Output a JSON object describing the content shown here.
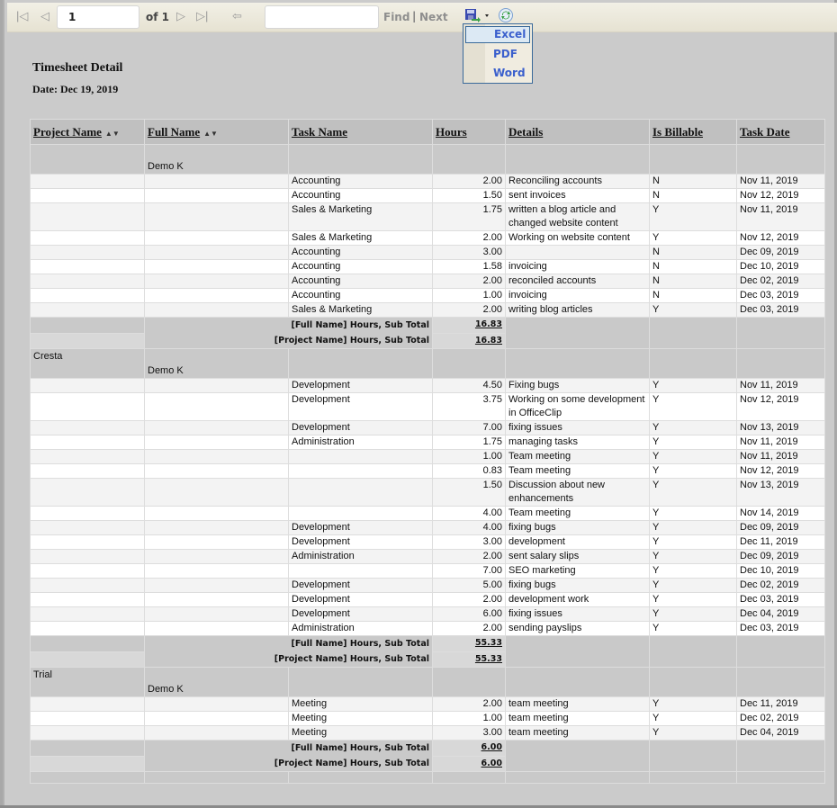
{
  "toolbar": {
    "page_value": "1",
    "of_label": "of 1",
    "find_placeholder": "",
    "find_label": "Find",
    "separator": "|",
    "next_label": "Next",
    "icons": [
      "first-page-icon",
      "prev-page-icon",
      "next-page-icon",
      "last-page-icon",
      "back-icon",
      "export-save-icon",
      "dropdown-arrow-icon",
      "refresh-icon"
    ]
  },
  "export_menu": {
    "items": [
      {
        "label": "Excel",
        "selected": true
      },
      {
        "label": "PDF",
        "selected": false
      },
      {
        "label": "Word",
        "selected": false
      }
    ]
  },
  "report": {
    "title": "Timesheet Detail",
    "date_label": "Date:  Dec 19, 2019"
  },
  "columns": [
    "Project Name",
    "Full Name",
    "Task Name",
    "Hours",
    "Details",
    "Is Billable",
    "Task Date"
  ],
  "sortable_columns": [
    "Project Name",
    "Full Name"
  ],
  "groups": [
    {
      "project": "",
      "full_name": "Demo K",
      "rows": [
        {
          "task": "Accounting",
          "hours": "2.00",
          "details": "Reconciling accounts",
          "billable": "N",
          "date": "Nov 11, 2019"
        },
        {
          "task": "Accounting",
          "hours": "1.50",
          "details": "sent invoices",
          "billable": "N",
          "date": "Nov 12, 2019"
        },
        {
          "task": "Sales & Marketing",
          "hours": "1.75",
          "details": "written a blog article and changed website content",
          "billable": "Y",
          "date": "Nov 11, 2019"
        },
        {
          "task": "Sales & Marketing",
          "hours": "2.00",
          "details": "Working on website content",
          "billable": "Y",
          "date": "Nov 12, 2019"
        },
        {
          "task": "Accounting",
          "hours": "3.00",
          "details": "",
          "billable": "N",
          "date": "Dec 09, 2019"
        },
        {
          "task": "Accounting",
          "hours": "1.58",
          "details": "invoicing",
          "billable": "N",
          "date": "Dec 10, 2019"
        },
        {
          "task": "Accounting",
          "hours": "2.00",
          "details": "reconciled accounts",
          "billable": "N",
          "date": "Dec 02, 2019"
        },
        {
          "task": "Accounting",
          "hours": "1.00",
          "details": "invoicing",
          "billable": "N",
          "date": "Dec 03, 2019"
        },
        {
          "task": "Sales & Marketing",
          "hours": "2.00",
          "details": "writing blog articles",
          "billable": "Y",
          "date": "Dec 03, 2019"
        }
      ],
      "fullname_subtotal_label": "[Full Name] Hours, Sub Total",
      "fullname_subtotal": "16.83",
      "project_subtotal_label": "[Project Name] Hours, Sub Total",
      "project_subtotal": "16.83"
    },
    {
      "project": "Cresta",
      "full_name": "Demo K",
      "rows": [
        {
          "task": "Development",
          "hours": "4.50",
          "details": "Fixing bugs",
          "billable": "Y",
          "date": "Nov 11, 2019"
        },
        {
          "task": "Development",
          "hours": "3.75",
          "details": "Working on some development in OfficeClip",
          "billable": "Y",
          "date": "Nov 12, 2019"
        },
        {
          "task": "Development",
          "hours": "7.00",
          "details": "fixing issues",
          "billable": "Y",
          "date": "Nov 13, 2019"
        },
        {
          "task": "Administration",
          "hours": "1.75",
          "details": "managing tasks",
          "billable": "Y",
          "date": "Nov 11, 2019"
        },
        {
          "task": "",
          "hours": "1.00",
          "details": "Team meeting",
          "billable": "Y",
          "date": "Nov 11, 2019"
        },
        {
          "task": "",
          "hours": "0.83",
          "details": "Team meeting",
          "billable": "Y",
          "date": "Nov 12, 2019"
        },
        {
          "task": "",
          "hours": "1.50",
          "details": "Discussion about new enhancements",
          "billable": "Y",
          "date": "Nov 13, 2019"
        },
        {
          "task": "",
          "hours": "4.00",
          "details": "Team meeting",
          "billable": "Y",
          "date": "Nov 14, 2019"
        },
        {
          "task": "Development",
          "hours": "4.00",
          "details": "fixing bugs",
          "billable": "Y",
          "date": "Dec 09, 2019"
        },
        {
          "task": "Development",
          "hours": "3.00",
          "details": "development",
          "billable": "Y",
          "date": "Dec 11, 2019"
        },
        {
          "task": "Administration",
          "hours": "2.00",
          "details": "sent salary slips",
          "billable": "Y",
          "date": "Dec 09, 2019"
        },
        {
          "task": "",
          "hours": "7.00",
          "details": "SEO marketing",
          "billable": "Y",
          "date": "Dec 10, 2019"
        },
        {
          "task": "Development",
          "hours": "5.00",
          "details": "fixing bugs",
          "billable": "Y",
          "date": "Dec 02, 2019"
        },
        {
          "task": "Development",
          "hours": "2.00",
          "details": "development work",
          "billable": "Y",
          "date": "Dec 03, 2019"
        },
        {
          "task": "Development",
          "hours": "6.00",
          "details": "fixing issues",
          "billable": "Y",
          "date": "Dec 04, 2019"
        },
        {
          "task": "Administration",
          "hours": "2.00",
          "details": "sending payslips",
          "billable": "Y",
          "date": "Dec 03, 2019"
        }
      ],
      "fullname_subtotal_label": "[Full Name] Hours, Sub Total",
      "fullname_subtotal": "55.33",
      "project_subtotal_label": "[Project Name] Hours, Sub Total",
      "project_subtotal": "55.33"
    },
    {
      "project": "Trial",
      "full_name": "Demo K",
      "rows": [
        {
          "task": "Meeting",
          "hours": "2.00",
          "details": "team meeting",
          "billable": "Y",
          "date": "Dec 11, 2019"
        },
        {
          "task": "Meeting",
          "hours": "1.00",
          "details": "team meeting",
          "billable": "Y",
          "date": "Dec 02, 2019"
        },
        {
          "task": "Meeting",
          "hours": "3.00",
          "details": "team meeting",
          "billable": "Y",
          "date": "Dec 04, 2019"
        }
      ],
      "fullname_subtotal_label": "[Full Name] Hours, Sub Total",
      "fullname_subtotal": "6.00",
      "project_subtotal_label": "[Project Name] Hours, Sub Total",
      "project_subtotal": "6.00"
    }
  ]
}
